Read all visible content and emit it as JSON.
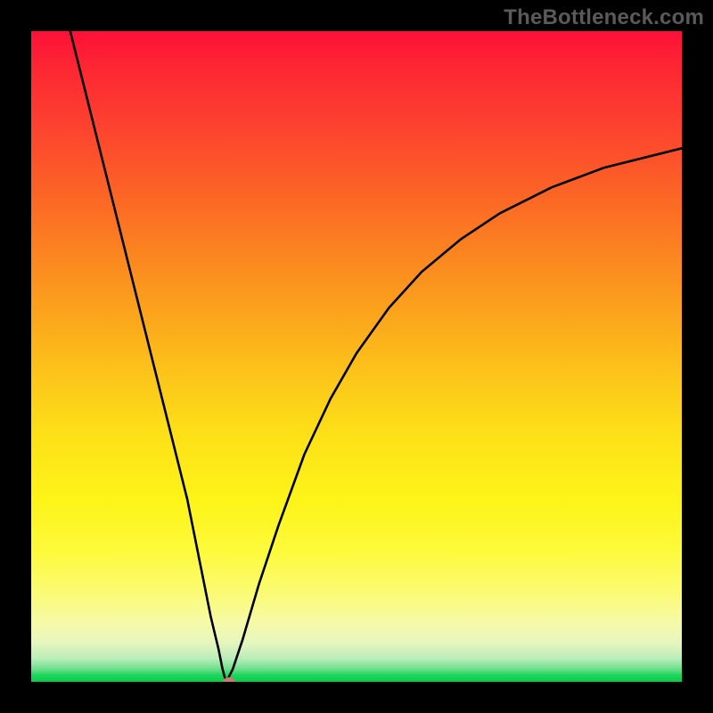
{
  "watermark": "TheBottleneck.com",
  "chart_data": {
    "type": "line",
    "title": "",
    "xlabel": "",
    "ylabel": "",
    "xlim": [
      0,
      100
    ],
    "ylim": [
      0,
      100
    ],
    "grid": false,
    "legend": false,
    "series": [
      {
        "name": "left-branch",
        "x": [
          6.0,
          9.0,
          12.0,
          15.0,
          18.0,
          21.0,
          24.0,
          26.0,
          27.6,
          28.8,
          29.4,
          29.8,
          30.0
        ],
        "y": [
          100.0,
          88.0,
          76.0,
          64.0,
          52.0,
          40.0,
          28.0,
          18.0,
          10.0,
          5.0,
          2.0,
          0.5,
          0.0
        ]
      },
      {
        "name": "right-branch",
        "x": [
          30.0,
          31.0,
          32.5,
          35.0,
          38.0,
          42.0,
          46.0,
          50.0,
          55.0,
          60.0,
          66.0,
          72.0,
          80.0,
          88.0,
          100.0
        ],
        "y": [
          0.0,
          2.0,
          6.5,
          15.0,
          24.0,
          35.0,
          43.5,
          50.5,
          57.5,
          63.0,
          68.0,
          72.0,
          76.0,
          79.0,
          82.0
        ]
      }
    ],
    "marker": {
      "x": 30.4,
      "y": 0.0
    },
    "background_gradient": {
      "direction": "vertical",
      "stops": [
        {
          "pos": 0.0,
          "color": "#fd1038"
        },
        {
          "pos": 0.5,
          "color": "#fcc21a"
        },
        {
          "pos": 0.8,
          "color": "#fdfa3c"
        },
        {
          "pos": 0.96,
          "color": "#b8edb8"
        },
        {
          "pos": 1.0,
          "color": "#06cd47"
        }
      ]
    }
  },
  "colors": {
    "curve": "#000000",
    "marker": "#c77c6f",
    "frame_bg": "#000000"
  }
}
